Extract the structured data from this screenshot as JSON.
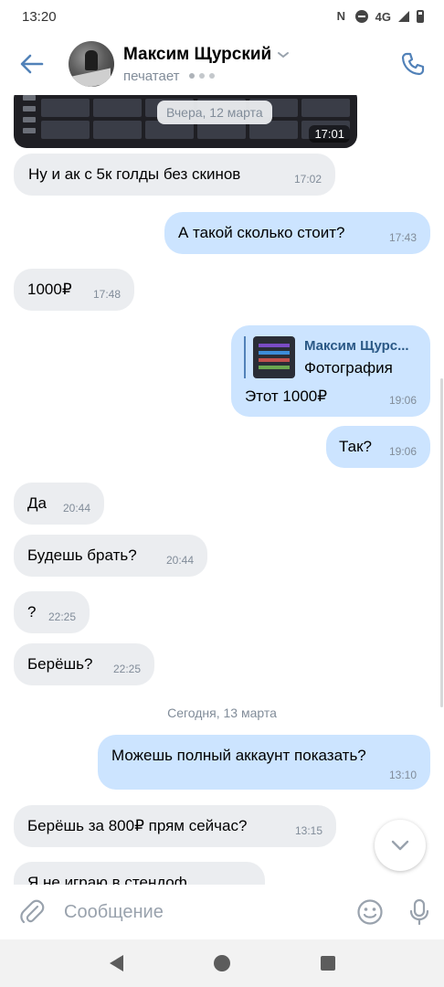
{
  "status_bar": {
    "time": "13:20",
    "network": "4G"
  },
  "header": {
    "contact_name": "Максим Щурский",
    "contact_status": "печатает"
  },
  "chat": {
    "photo_time": "17:01",
    "date_pill": "Вчера, 12 марта",
    "today_separator": "Сегодня, 13 марта",
    "messages": [
      {
        "dir": "in",
        "text": "Ну и ак с 5к голды без скинов",
        "time": "17:02"
      },
      {
        "dir": "out",
        "text": "А такой сколько стоит?",
        "time": "17:43"
      },
      {
        "dir": "in",
        "text": "1000₽",
        "time": "17:48"
      },
      {
        "dir": "out",
        "reply_author": "Максим Щурс...",
        "reply_caption": "Фотография",
        "text": "Этот 1000₽",
        "time": "19:06"
      },
      {
        "dir": "out",
        "text": "Так?",
        "time": "19:06"
      },
      {
        "dir": "in",
        "text": "Да",
        "time": "20:44"
      },
      {
        "dir": "in",
        "text": "Будешь брать?",
        "time": "20:44"
      },
      {
        "dir": "in",
        "text": "?",
        "time": "22:25"
      },
      {
        "dir": "in",
        "text": "Берёшь?",
        "time": "22:25"
      },
      {
        "dir": "out",
        "text": "Можешь полный аккаунт показать?",
        "time": "13:10"
      },
      {
        "dir": "in",
        "text": "Берёшь за 800₽ прям сейчас?",
        "time": "13:15"
      },
      {
        "dir": "in",
        "text": "Я не играю в стендоф",
        "time": ""
      }
    ]
  },
  "composer": {
    "placeholder": "Сообщение"
  },
  "icons": {
    "back": "arrow-left-icon",
    "call": "phone-icon",
    "attach": "paperclip-icon",
    "emoji": "smile-icon",
    "mic": "microphone-icon",
    "scroll_down": "chevron-down-icon"
  },
  "colors": {
    "accent": "#5181b8",
    "incoming_bubble": "#ebedf0",
    "outgoing_bubble": "#cce4ff",
    "meta_text": "#818c99"
  }
}
